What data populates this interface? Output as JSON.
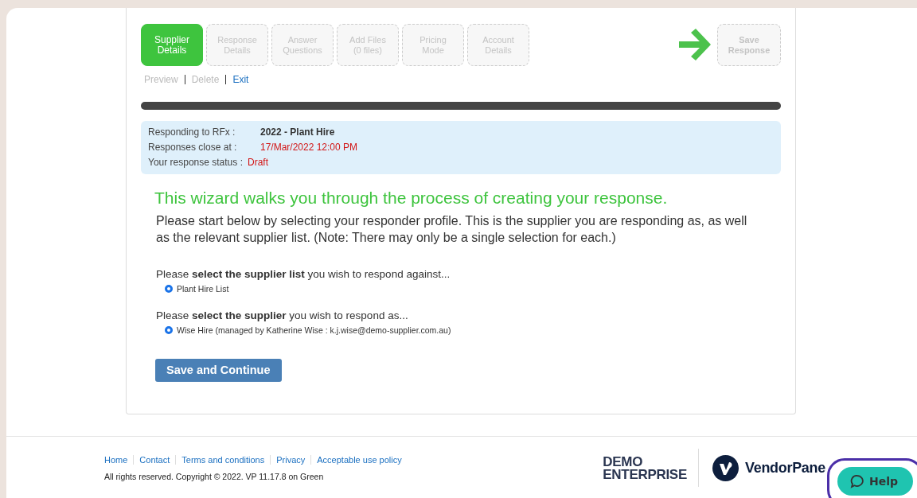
{
  "wizard": {
    "steps": [
      {
        "lines": [
          "Supplier",
          "Details"
        ],
        "selected": true
      },
      {
        "lines": [
          "Response",
          "Details"
        ],
        "selected": false
      },
      {
        "lines": [
          "Answer",
          "Questions"
        ],
        "selected": false
      },
      {
        "lines": [
          "Add Files",
          "(0 files)"
        ],
        "selected": false
      },
      {
        "lines": [
          "Pricing",
          "Mode"
        ],
        "selected": false
      },
      {
        "lines": [
          "Account",
          "Details"
        ],
        "selected": false
      }
    ],
    "save": {
      "lines": [
        "Save",
        "Response"
      ],
      "disabled": true
    },
    "links": [
      {
        "label": "Preview",
        "disabled": true
      },
      {
        "label": "Delete",
        "disabled": true
      },
      {
        "label": "Exit",
        "disabled": false
      }
    ],
    "progress": {
      "level": 1
    }
  },
  "info": [
    {
      "label": "Responding to RFx :",
      "value": "2022 - Plant Hire",
      "kind": "bold"
    },
    {
      "label": "Responses close at :",
      "value": "17/Mar/2022 12:00 PM",
      "kind": "alert"
    },
    {
      "label": "Your response status :",
      "value": "Draft",
      "kind": "alert"
    }
  ],
  "heading": "This wizard walks you through the process of creating your response.",
  "intro": "Please start below by selecting your responder profile. This is the supplier you are responding as, as well as the relevant supplier list. (Note: There may only be a single selection for each.)",
  "questions": [
    {
      "prompt": "Please **select the supplier list** you wish to respond against...",
      "options": [
        {
          "label": "Plant Hire List",
          "selected": true
        }
      ]
    },
    {
      "prompt": "Please **select the supplier** you wish to respond as...",
      "options": [
        {
          "label": "Wise Hire (managed by Katherine Wise : k.j.wise@demo-supplier.com.au)",
          "selected": true
        }
      ]
    }
  ],
  "submit": "Save and Continue",
  "footer": {
    "links": [
      "Home",
      "Contact",
      "Terms and conditions",
      "Privacy",
      "Acceptable use policy"
    ],
    "copyright": "All rights reserved. Copyright © 2022. VP 11.17.8 on Green",
    "logos": {
      "demo": [
        "DEMO",
        "ENTERPRISE"
      ],
      "vendor": "VendorPane"
    }
  },
  "help": {
    "label": "Help",
    "highlighted": true
  }
}
